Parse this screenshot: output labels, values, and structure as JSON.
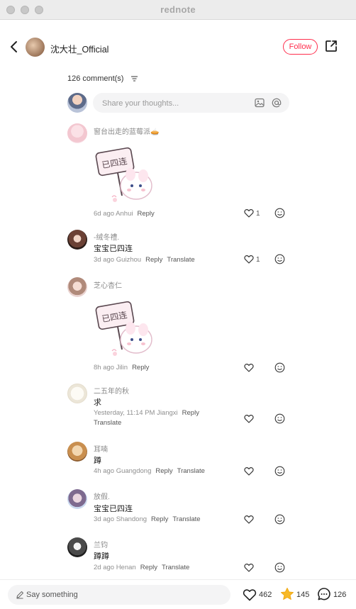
{
  "window": {
    "title": "rednote"
  },
  "header": {
    "author_name": "沈大壮_Official",
    "follow_label": "Follow"
  },
  "comments_header": {
    "count_label": "126 comment(s)"
  },
  "composer": {
    "placeholder": "Share your thoughts..."
  },
  "comments": [
    {
      "name": "窗台出走的蓝莓派🥧",
      "text": "",
      "has_sticker": true,
      "sticker_text": "已四连",
      "meta": "6d ago Anhui",
      "reply": "Reply",
      "translate": "",
      "likes": "1"
    },
    {
      "name": "-绒冬禮.",
      "text": "宝宝已四连",
      "has_sticker": false,
      "meta": "3d ago Guizhou",
      "reply": "Reply",
      "translate": "Translate",
      "likes": "1"
    },
    {
      "name": "芝心杏仁",
      "text": "",
      "has_sticker": true,
      "sticker_text": "已四连",
      "meta": "8h ago Jilin",
      "reply": "Reply",
      "translate": "",
      "likes": ""
    },
    {
      "name": "二五年的秋",
      "text": "求",
      "has_sticker": false,
      "meta": "Yesterday, 11:14 PM Jiangxi",
      "reply": "Reply",
      "translate": "Translate",
      "likes": ""
    },
    {
      "name": "耳喃",
      "text": "蹲",
      "has_sticker": false,
      "meta": "4h ago Guangdong",
      "reply": "Reply",
      "translate": "Translate",
      "likes": ""
    },
    {
      "name": "放假.",
      "text": "宝宝已四连",
      "has_sticker": false,
      "meta": "3d ago Shandong",
      "reply": "Reply",
      "translate": "Translate",
      "likes": ""
    },
    {
      "name": "兰钧",
      "text": "蹲蹲",
      "has_sticker": false,
      "meta": "2d ago Henan",
      "reply": "Reply",
      "translate": "Translate",
      "likes": ""
    }
  ],
  "bottom_bar": {
    "placeholder": "Say something",
    "likes": "462",
    "favorites": "145",
    "comments": "126"
  },
  "colors": {
    "accent": "#ff2e4d",
    "star": "#f7b928"
  }
}
